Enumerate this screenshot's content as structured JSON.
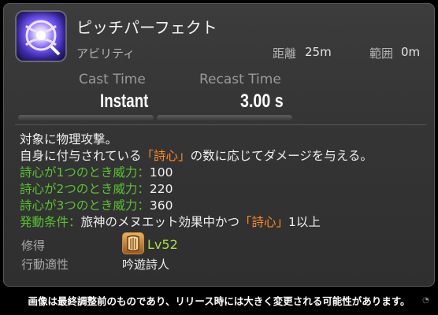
{
  "action": {
    "name": "ピッチパーフェクト",
    "category": "アビリティ",
    "range_label": "距離",
    "range_value": "25m",
    "radius_label": "範囲",
    "radius_value": "0m"
  },
  "timing": {
    "cast_label": "Cast Time",
    "cast_value": "Instant",
    "recast_label": "Recast Time",
    "recast_value": "3.00 s"
  },
  "description": {
    "line1": "対象に物理攻撃。",
    "line2_pre": "自身に付与されている",
    "line2_term": "「詩心」",
    "line2_post": "の数に応じてダメージを与える。",
    "line3_label": "詩心が1つのとき威力：",
    "line3_value": "100",
    "line4_label": "詩心が2つのとき威力：",
    "line4_value": "220",
    "line5_label": "詩心が3つのとき威力：",
    "line5_value": "360",
    "line6_label": "発動条件：",
    "line6_text": "旅神のメヌエット効果中かつ",
    "line6_term": "「詩心」",
    "line6_post": "1以上"
  },
  "acquired": {
    "label": "修得",
    "level": "Lv52",
    "job_icon": "bard-job-icon"
  },
  "affinity": {
    "label": "行動適性",
    "value": "吟遊詩人"
  },
  "footer": {
    "disclaimer": "画像は最終調整前のものであり、リリース時には大きく変更される可能性があります。"
  },
  "colors": {
    "label_green": "#57c42f",
    "term_orange": "#ff8c2a",
    "level_green": "#aedc4a"
  }
}
